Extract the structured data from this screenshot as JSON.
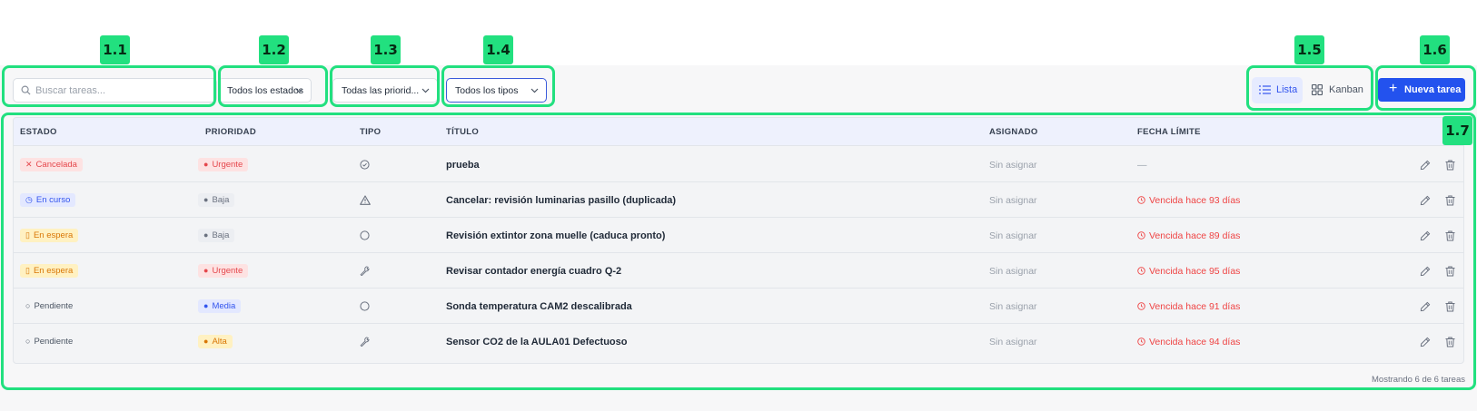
{
  "annotations": [
    "1.1",
    "1.2",
    "1.3",
    "1.4",
    "1.5",
    "1.6",
    "1.7"
  ],
  "toolbar": {
    "search_placeholder": "Buscar tareas...",
    "status_filter": "Todos los estados",
    "priority_filter": "Todas las priorid...",
    "type_filter": "Todos los tipos",
    "view_list": "Lista",
    "view_kanban": "Kanban",
    "new_task": "Nueva tarea"
  },
  "table": {
    "headers": [
      "ESTADO",
      "PRIORIDAD",
      "TIPO",
      "TÍTULO",
      "ASIGNADO",
      "FECHA LÍMITE"
    ],
    "rows": [
      {
        "estado": "Cancelada",
        "estado_icon": "x-icon",
        "prioridad": "Urgente",
        "tipo_icon": "check-circle-icon",
        "titulo": "prueba",
        "asignado": "Sin asignar",
        "fecha": "—",
        "vencida": false
      },
      {
        "estado": "En curso",
        "estado_icon": "clock-icon",
        "prioridad": "Baja",
        "tipo_icon": "warning-triangle-icon",
        "titulo": "Cancelar: revisión luminarias pasillo (duplicada)",
        "asignado": "Sin asignar",
        "fecha": "Vencida hace 93 días",
        "vencida": true
      },
      {
        "estado": "En espera",
        "estado_icon": "pause-icon",
        "prioridad": "Baja",
        "tipo_icon": "circle-icon",
        "titulo": "Revisión extintor zona muelle (caduca pronto)",
        "asignado": "Sin asignar",
        "fecha": "Vencida hace 89 días",
        "vencida": true
      },
      {
        "estado": "En espera",
        "estado_icon": "pause-icon",
        "prioridad": "Urgente",
        "tipo_icon": "wrench-icon",
        "titulo": "Revisar contador energía cuadro Q-2",
        "asignado": "Sin asignar",
        "fecha": "Vencida hace 95 días",
        "vencida": true
      },
      {
        "estado": "Pendiente",
        "estado_icon": "circle-icon",
        "prioridad": "Media",
        "tipo_icon": "circle-icon",
        "titulo": "Sonda temperatura CAM2 descalibrada",
        "asignado": "Sin asignar",
        "fecha": "Vencida hace 91 días",
        "vencida": true
      },
      {
        "estado": "Pendiente",
        "estado_icon": "circle-icon",
        "prioridad": "Alta",
        "tipo_icon": "wrench-icon",
        "titulo": "Sensor CO2 de la AULA01 Defectuoso",
        "asignado": "Sin asignar",
        "fecha": "Vencida hace 94 días",
        "vencida": true
      }
    ]
  },
  "footer": "Mostrando 6 de 6 tareas",
  "colors": {
    "accent": "#2352ee",
    "annotation": "#22e07f",
    "overdue": "#ef4444",
    "header_bg": "#eef1fd"
  }
}
